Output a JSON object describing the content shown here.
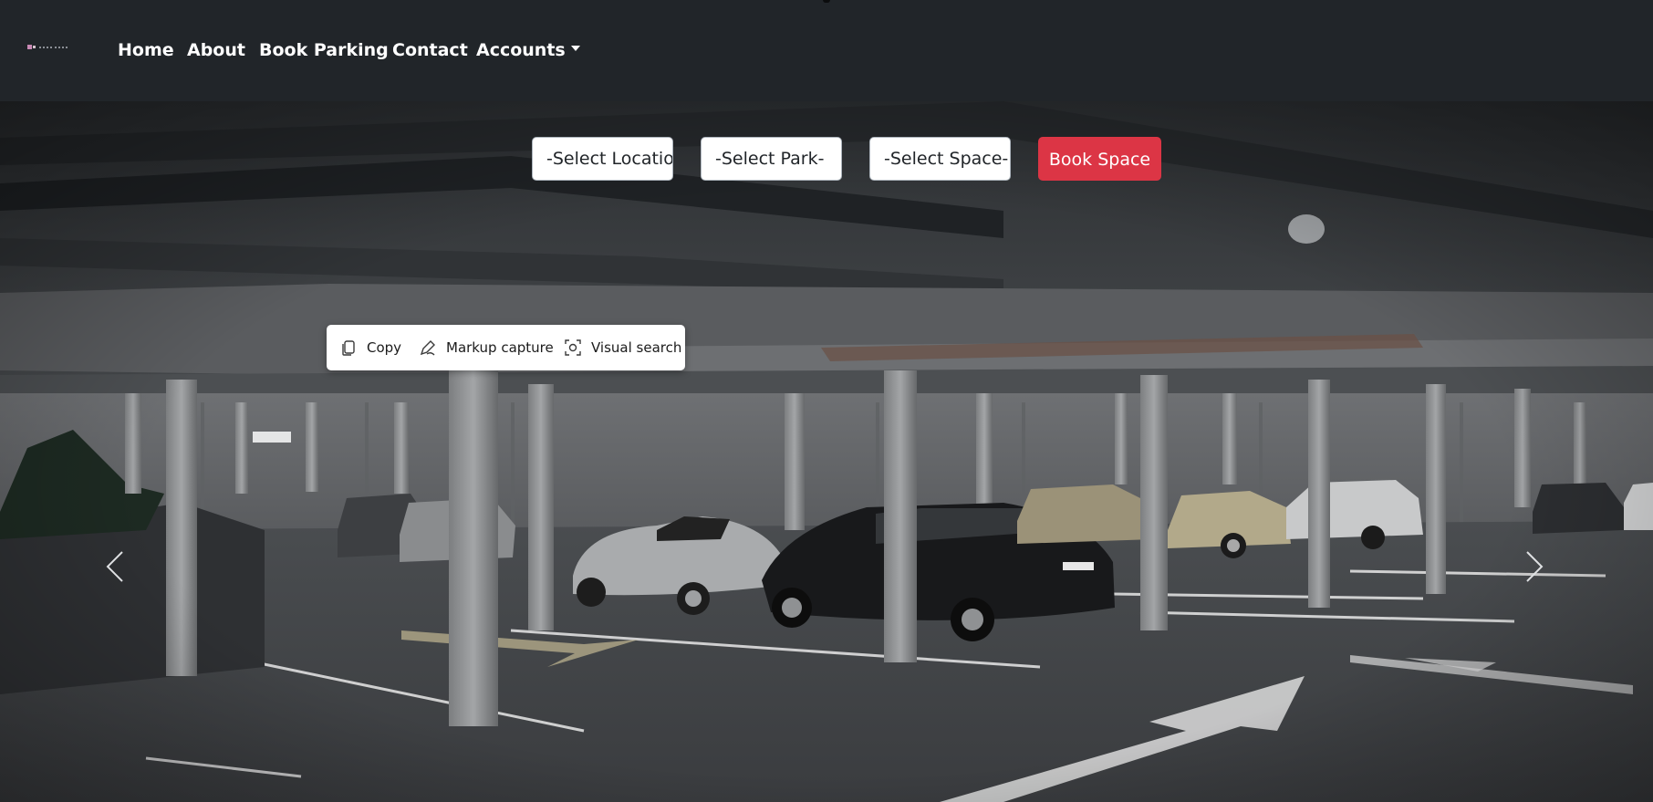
{
  "nav": {
    "links": [
      {
        "label": "Home"
      },
      {
        "label": "About"
      },
      {
        "label": "Book Parking"
      },
      {
        "label": "Contact"
      },
      {
        "label": "Accounts",
        "has_dropdown": true
      }
    ]
  },
  "booking": {
    "location_select": "-Select Location-",
    "park_select": "-Select Park-",
    "space_select": "-Select Space-",
    "book_button": "Book Space",
    "accent_color": "#dc3545"
  },
  "context_toolbar": {
    "copy_label": "Copy",
    "markup_label": "Markup capture",
    "visual_search_label": "Visual search"
  },
  "carousel": {
    "prev_icon": "chevron-left-icon",
    "next_icon": "chevron-right-icon"
  },
  "colors": {
    "navbar_bg": "#212529",
    "nav_text": "#ffffff",
    "book_button_bg": "#dc3545"
  }
}
